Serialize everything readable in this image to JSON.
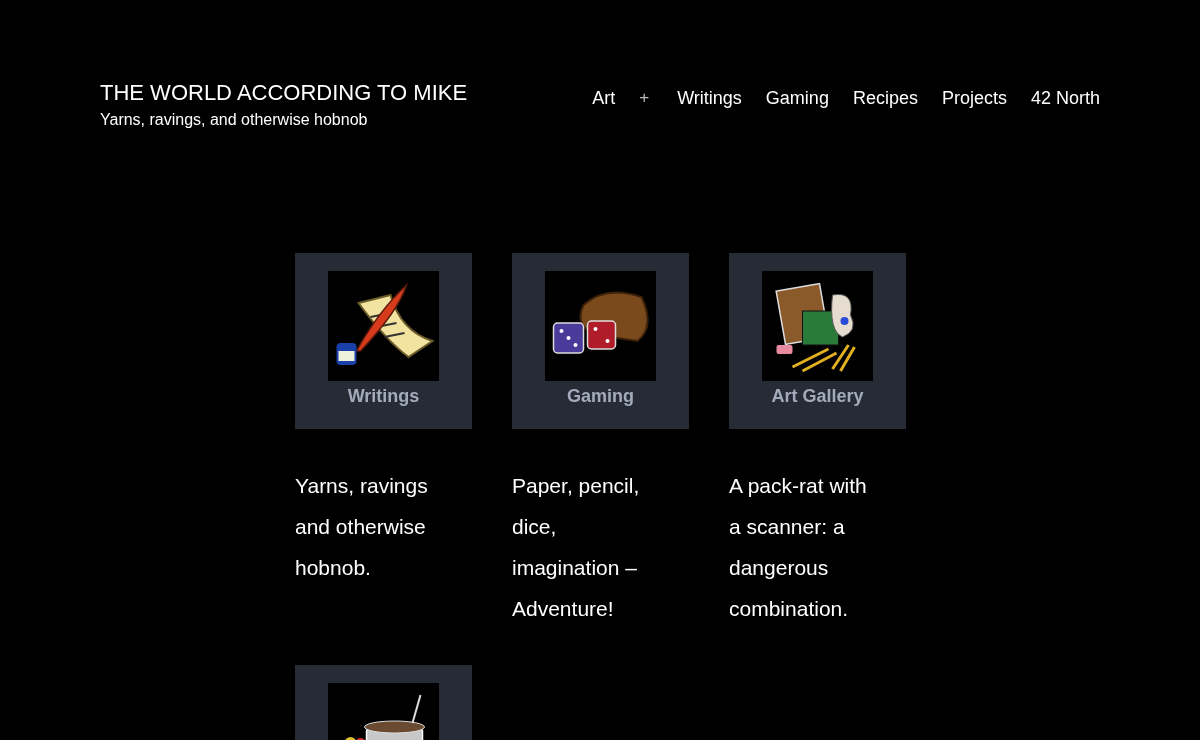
{
  "site": {
    "title": "THE WORLD ACCORDING TO MIKE",
    "tagline": "Yarns, ravings, and otherwise hobnob"
  },
  "nav": [
    {
      "label": "Art",
      "submenu_toggle": "+"
    },
    {
      "label": "Writings"
    },
    {
      "label": "Gaming"
    },
    {
      "label": "Recipes"
    },
    {
      "label": "Projects"
    },
    {
      "label": "42 North"
    }
  ],
  "cards": [
    {
      "kind": "labeled",
      "label": "Writings",
      "description": "Yarns, ravings and otherwise hobnob."
    },
    {
      "kind": "labeled",
      "label": "Gaming",
      "description": "Paper, pencil, dice, imagination – Adventure!"
    },
    {
      "kind": "labeled",
      "label": "Art Gallery",
      "description": "A pack-rat with a scanner: a dangerous combination."
    },
    {
      "kind": "image_only"
    }
  ]
}
